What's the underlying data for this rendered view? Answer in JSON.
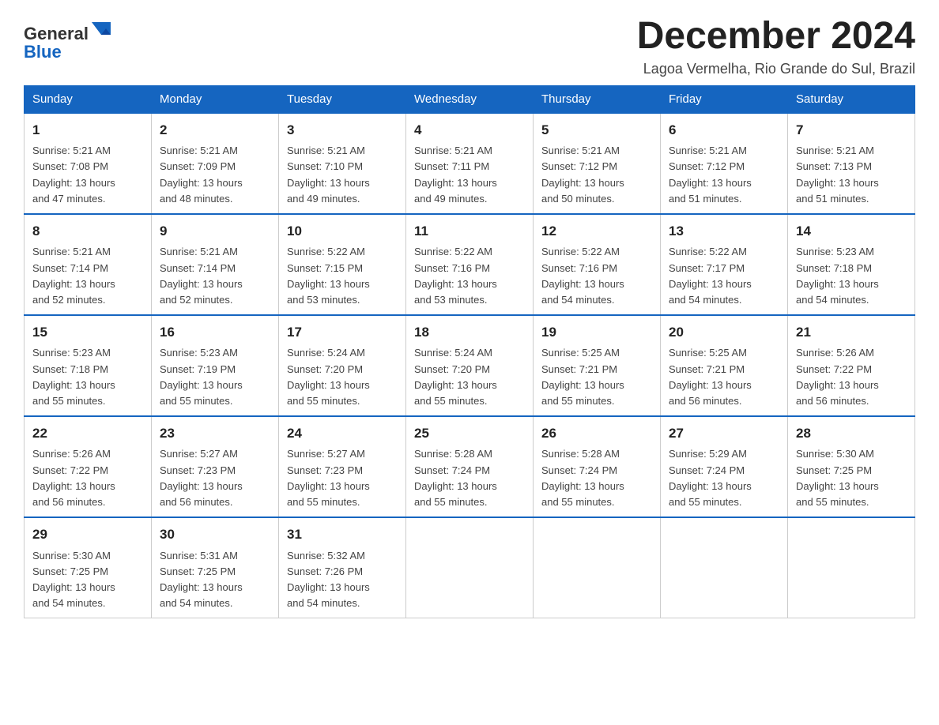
{
  "logo": {
    "text_general": "General",
    "text_blue": "Blue"
  },
  "title": "December 2024",
  "subtitle": "Lagoa Vermelha, Rio Grande do Sul, Brazil",
  "weekdays": [
    "Sunday",
    "Monday",
    "Tuesday",
    "Wednesday",
    "Thursday",
    "Friday",
    "Saturday"
  ],
  "weeks": [
    [
      {
        "day": "1",
        "sunrise": "5:21 AM",
        "sunset": "7:08 PM",
        "daylight": "13 hours and 47 minutes."
      },
      {
        "day": "2",
        "sunrise": "5:21 AM",
        "sunset": "7:09 PM",
        "daylight": "13 hours and 48 minutes."
      },
      {
        "day": "3",
        "sunrise": "5:21 AM",
        "sunset": "7:10 PM",
        "daylight": "13 hours and 49 minutes."
      },
      {
        "day": "4",
        "sunrise": "5:21 AM",
        "sunset": "7:11 PM",
        "daylight": "13 hours and 49 minutes."
      },
      {
        "day": "5",
        "sunrise": "5:21 AM",
        "sunset": "7:12 PM",
        "daylight": "13 hours and 50 minutes."
      },
      {
        "day": "6",
        "sunrise": "5:21 AM",
        "sunset": "7:12 PM",
        "daylight": "13 hours and 51 minutes."
      },
      {
        "day": "7",
        "sunrise": "5:21 AM",
        "sunset": "7:13 PM",
        "daylight": "13 hours and 51 minutes."
      }
    ],
    [
      {
        "day": "8",
        "sunrise": "5:21 AM",
        "sunset": "7:14 PM",
        "daylight": "13 hours and 52 minutes."
      },
      {
        "day": "9",
        "sunrise": "5:21 AM",
        "sunset": "7:14 PM",
        "daylight": "13 hours and 52 minutes."
      },
      {
        "day": "10",
        "sunrise": "5:22 AM",
        "sunset": "7:15 PM",
        "daylight": "13 hours and 53 minutes."
      },
      {
        "day": "11",
        "sunrise": "5:22 AM",
        "sunset": "7:16 PM",
        "daylight": "13 hours and 53 minutes."
      },
      {
        "day": "12",
        "sunrise": "5:22 AM",
        "sunset": "7:16 PM",
        "daylight": "13 hours and 54 minutes."
      },
      {
        "day": "13",
        "sunrise": "5:22 AM",
        "sunset": "7:17 PM",
        "daylight": "13 hours and 54 minutes."
      },
      {
        "day": "14",
        "sunrise": "5:23 AM",
        "sunset": "7:18 PM",
        "daylight": "13 hours and 54 minutes."
      }
    ],
    [
      {
        "day": "15",
        "sunrise": "5:23 AM",
        "sunset": "7:18 PM",
        "daylight": "13 hours and 55 minutes."
      },
      {
        "day": "16",
        "sunrise": "5:23 AM",
        "sunset": "7:19 PM",
        "daylight": "13 hours and 55 minutes."
      },
      {
        "day": "17",
        "sunrise": "5:24 AM",
        "sunset": "7:20 PM",
        "daylight": "13 hours and 55 minutes."
      },
      {
        "day": "18",
        "sunrise": "5:24 AM",
        "sunset": "7:20 PM",
        "daylight": "13 hours and 55 minutes."
      },
      {
        "day": "19",
        "sunrise": "5:25 AM",
        "sunset": "7:21 PM",
        "daylight": "13 hours and 55 minutes."
      },
      {
        "day": "20",
        "sunrise": "5:25 AM",
        "sunset": "7:21 PM",
        "daylight": "13 hours and 56 minutes."
      },
      {
        "day": "21",
        "sunrise": "5:26 AM",
        "sunset": "7:22 PM",
        "daylight": "13 hours and 56 minutes."
      }
    ],
    [
      {
        "day": "22",
        "sunrise": "5:26 AM",
        "sunset": "7:22 PM",
        "daylight": "13 hours and 56 minutes."
      },
      {
        "day": "23",
        "sunrise": "5:27 AM",
        "sunset": "7:23 PM",
        "daylight": "13 hours and 56 minutes."
      },
      {
        "day": "24",
        "sunrise": "5:27 AM",
        "sunset": "7:23 PM",
        "daylight": "13 hours and 55 minutes."
      },
      {
        "day": "25",
        "sunrise": "5:28 AM",
        "sunset": "7:24 PM",
        "daylight": "13 hours and 55 minutes."
      },
      {
        "day": "26",
        "sunrise": "5:28 AM",
        "sunset": "7:24 PM",
        "daylight": "13 hours and 55 minutes."
      },
      {
        "day": "27",
        "sunrise": "5:29 AM",
        "sunset": "7:24 PM",
        "daylight": "13 hours and 55 minutes."
      },
      {
        "day": "28",
        "sunrise": "5:30 AM",
        "sunset": "7:25 PM",
        "daylight": "13 hours and 55 minutes."
      }
    ],
    [
      {
        "day": "29",
        "sunrise": "5:30 AM",
        "sunset": "7:25 PM",
        "daylight": "13 hours and 54 minutes."
      },
      {
        "day": "30",
        "sunrise": "5:31 AM",
        "sunset": "7:25 PM",
        "daylight": "13 hours and 54 minutes."
      },
      {
        "day": "31",
        "sunrise": "5:32 AM",
        "sunset": "7:26 PM",
        "daylight": "13 hours and 54 minutes."
      },
      null,
      null,
      null,
      null
    ]
  ],
  "labels": {
    "sunrise": "Sunrise:",
    "sunset": "Sunset:",
    "daylight": "Daylight:"
  }
}
